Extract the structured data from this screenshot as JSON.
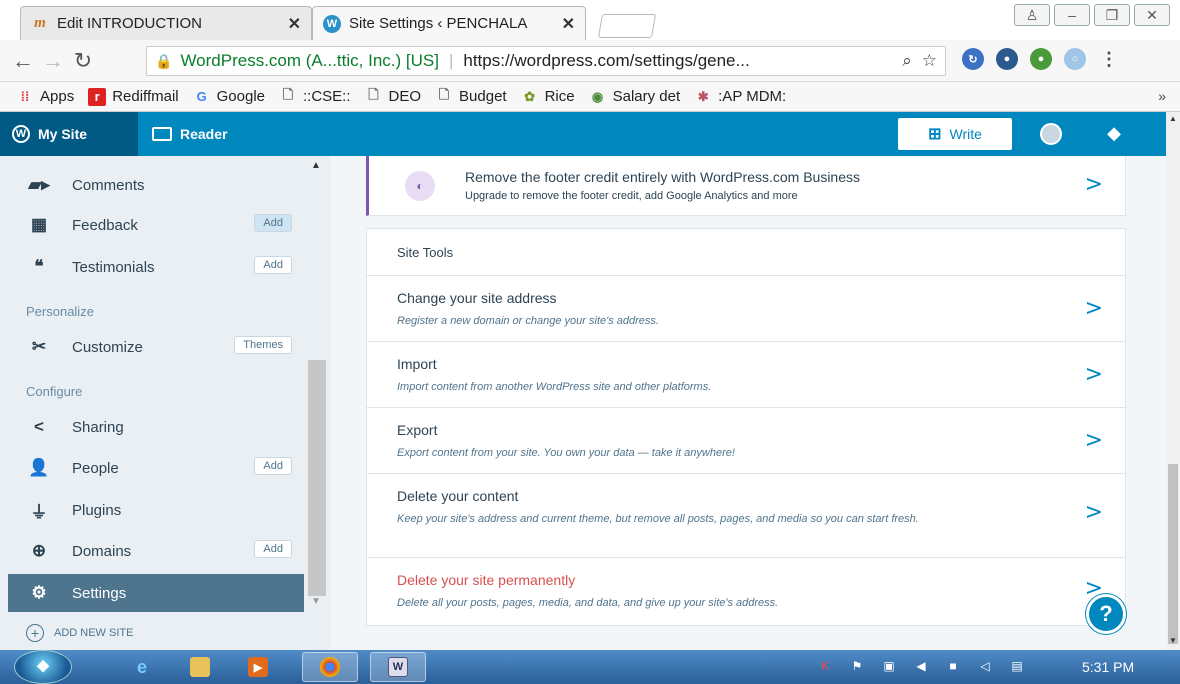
{
  "browser": {
    "tabs": [
      {
        "title": "Edit INTRODUCTION",
        "icon": "mn-favicon"
      },
      {
        "title": "Site Settings ‹ PENCHALA",
        "icon": "wordpress-favicon"
      }
    ],
    "omnibox": {
      "secure_label": "WordPress.com (A...ttic, Inc.) [US]",
      "url": "https://wordpress.com/settings/gene..."
    },
    "bookmarks": [
      {
        "label": "Apps",
        "icon": "apps-grid-icon"
      },
      {
        "label": "Rediffmail",
        "icon": "rediff-icon"
      },
      {
        "label": "Google",
        "icon": "google-icon"
      },
      {
        "label": "::CSE::",
        "icon": "page-icon"
      },
      {
        "label": "DEO",
        "icon": "page-icon"
      },
      {
        "label": "Budget",
        "icon": "page-icon"
      },
      {
        "label": "Rice",
        "icon": "rice-icon"
      },
      {
        "label": "Salary det",
        "icon": "salary-icon"
      },
      {
        "label": ":AP MDM:",
        "icon": "mdm-icon"
      }
    ],
    "bookmarks_more": "»"
  },
  "masterbar": {
    "my_site": "My Site",
    "reader": "Reader",
    "write": "Write"
  },
  "sidebar": {
    "items": [
      {
        "label": "Comments",
        "icon": "comments-icon",
        "action": ""
      },
      {
        "label": "Feedback",
        "icon": "feedback-icon",
        "action": "Add"
      },
      {
        "label": "Testimonials",
        "icon": "quote-icon",
        "action": "Add"
      },
      {
        "label": "Customize",
        "icon": "customize-icon",
        "action": "Themes"
      },
      {
        "label": "Sharing",
        "icon": "share-icon",
        "action": ""
      },
      {
        "label": "People",
        "icon": "people-icon",
        "action": "Add"
      },
      {
        "label": "Plugins",
        "icon": "plug-icon",
        "action": ""
      },
      {
        "label": "Domains",
        "icon": "globe-icon",
        "action": "Add"
      },
      {
        "label": "Settings",
        "icon": "gear-icon",
        "action": ""
      }
    ],
    "headings": {
      "personalize": "Personalize",
      "configure": "Configure"
    },
    "add_new_site": "ADD NEW SITE"
  },
  "main": {
    "upsell": {
      "title": "Remove the footer credit entirely with WordPress.com Business",
      "subtitle": "Upgrade to remove the footer credit, add Google Analytics and more"
    },
    "site_tools_header": "Site Tools",
    "tools": [
      {
        "title": "Change your site address",
        "desc": "Register a new domain or change your site's address."
      },
      {
        "title": "Import",
        "desc": "Import content from another WordPress site and other platforms."
      },
      {
        "title": "Export",
        "desc": "Export content from your site. You own your data — take it anywhere!"
      },
      {
        "title": "Delete your content",
        "desc": "Keep your site's address and current theme, but remove all posts, pages, and media so you can start fresh."
      },
      {
        "title": "Delete your site permanently",
        "desc": "Delete all your posts, pages, media, and data, and give up your site's address."
      }
    ]
  },
  "taskbar": {
    "clock": "5:31 PM"
  },
  "colors": {
    "masterbar": "#0087be",
    "my_site_bg": "#005a84",
    "sidebar_selected": "#4f748e",
    "danger": "#d94f4f",
    "upsell_accent": "#7f54b3"
  }
}
